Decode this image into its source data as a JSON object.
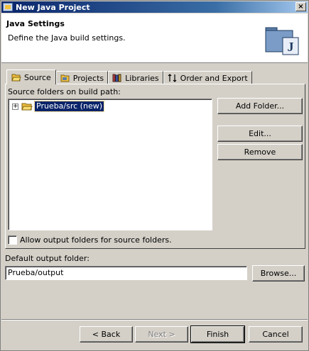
{
  "window": {
    "title": "New Java Project",
    "close_glyph": "×"
  },
  "banner": {
    "title": "Java Settings",
    "description": "Define the Java build settings.",
    "icon": "java-project-folder-icon",
    "icon_letter": "J"
  },
  "tabs": [
    {
      "label": "Source",
      "icon": "folder-open-icon",
      "active": true
    },
    {
      "label": "Projects",
      "icon": "projects-icon",
      "active": false
    },
    {
      "label": "Libraries",
      "icon": "libraries-icon",
      "active": false
    },
    {
      "label": "Order and Export",
      "icon": "order-arrows-icon",
      "active": false
    }
  ],
  "source": {
    "label": "Source folders on build path:",
    "tree": [
      {
        "label": "Prueba/src (new)",
        "expander": "+",
        "selected": true
      }
    ],
    "buttons": {
      "add_folder": "Add Folder...",
      "edit": "Edit...",
      "remove": "Remove"
    },
    "allow_output_checkbox": {
      "label": "Allow output folders for source folders.",
      "checked": false
    }
  },
  "output": {
    "label": "Default output folder:",
    "value": "Prueba/output",
    "browse": "Browse..."
  },
  "footer": {
    "back": "< Back",
    "next": "Next >",
    "finish": "Finish",
    "cancel": "Cancel"
  },
  "colors": {
    "title_bar": "#0a246a",
    "selection": "#0a246a",
    "dialog_bg": "#d4d0c8",
    "folder": "#f0c040"
  }
}
